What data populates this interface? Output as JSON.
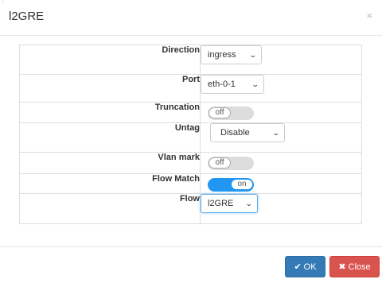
{
  "dialog": {
    "title": "l2GRE",
    "close_glyph": "×"
  },
  "rows": {
    "direction": {
      "label": "Direction",
      "value": "ingress"
    },
    "port": {
      "label": "Port",
      "value": "eth-0-1"
    },
    "truncation": {
      "label": "Truncation",
      "state": "off"
    },
    "untag": {
      "label": "Untag",
      "value": "Disable"
    },
    "vlan_mark": {
      "label": "Vlan mark",
      "state": "off"
    },
    "flow_match": {
      "label": "Flow Match",
      "state": "on"
    },
    "flow": {
      "label": "Flow",
      "value": "l2GRE"
    }
  },
  "footer": {
    "ok_label": "OK",
    "close_label": "Close"
  },
  "colors": {
    "primary": "#337ab7",
    "danger": "#d9534f",
    "toggle_on": "#2196f3",
    "toggle_off": "#dddddd"
  },
  "icons": {
    "ok": "check-icon",
    "close": "x-icon"
  }
}
